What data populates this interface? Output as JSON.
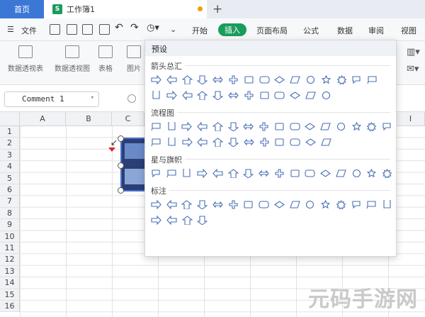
{
  "tabs": {
    "home": "首页",
    "doc_icon": "S",
    "doc_title": "工作簿1",
    "add": "+"
  },
  "menu": {
    "file": "文件",
    "start": "开始",
    "insert": "插入",
    "page_layout": "页面布局",
    "formula": "公式",
    "data": "数据",
    "review": "审阅",
    "view": "视图"
  },
  "ribbon": {
    "pivot_table": "数据透视表",
    "pivot_chart": "数据透视图",
    "table": "表格",
    "picture": "图片"
  },
  "formula_bar": {
    "name_box": "Comment 1"
  },
  "columns": [
    "A",
    "B",
    "C",
    "I"
  ],
  "rows": [
    "1",
    "2",
    "3",
    "4",
    "5",
    "6",
    "7",
    "8",
    "9",
    "10",
    "11",
    "12",
    "13",
    "14",
    "15",
    "16"
  ],
  "shapes_panel": {
    "preset": "预设",
    "sections": [
      {
        "title": "箭头总汇",
        "rows": [
          15,
          12
        ]
      },
      {
        "title": "流程图",
        "rows": [
          16,
          12
        ]
      },
      {
        "title": "星与旗帜",
        "rows": [
          16
        ]
      },
      {
        "title": "标注",
        "rows": [
          16,
          4
        ]
      }
    ]
  },
  "watermark": "元码手游网"
}
